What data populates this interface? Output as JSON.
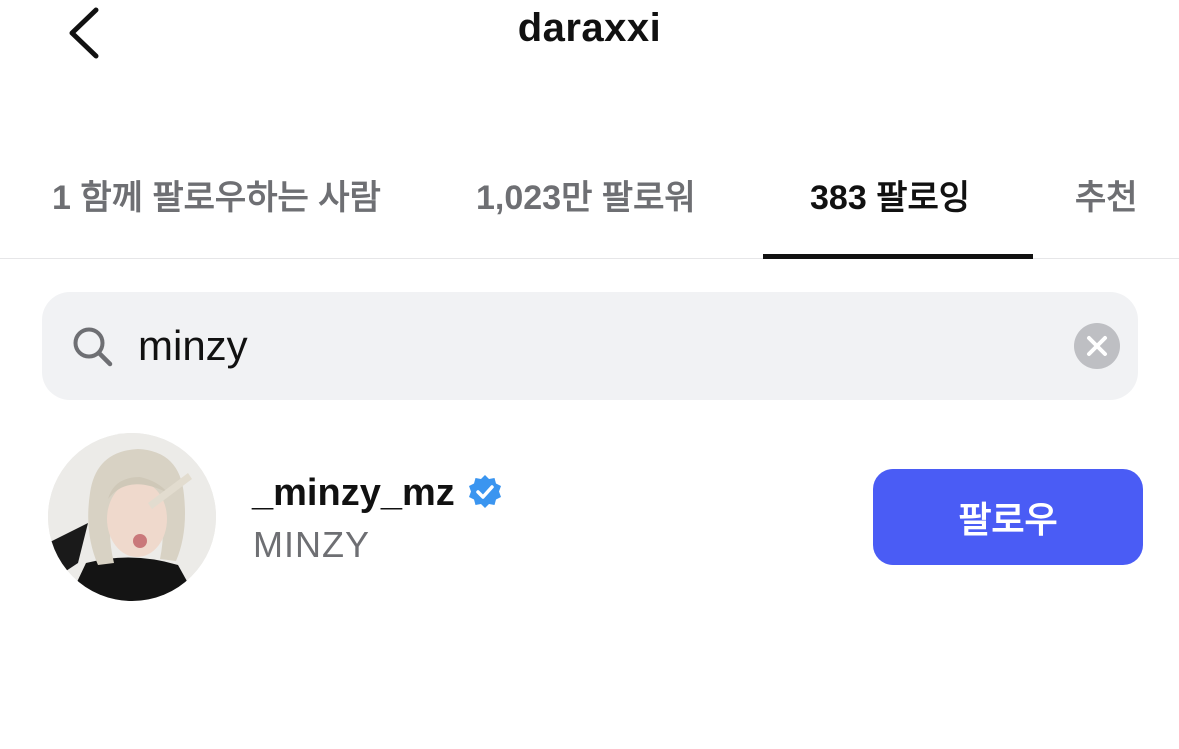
{
  "header": {
    "title": "daraxxi",
    "back_icon": "chevron-left-icon"
  },
  "tabs": [
    {
      "label": "1 함께 팔로우하는 사람",
      "active": false
    },
    {
      "label": "1,023만 팔로워",
      "active": false
    },
    {
      "label": "383 팔로잉",
      "active": true
    },
    {
      "label": "추천",
      "active": false
    }
  ],
  "search": {
    "value": "minzy",
    "icon": "search-icon",
    "clear_icon": "close-icon"
  },
  "results": [
    {
      "username": "_minzy_mz",
      "display_name": "MINZY",
      "verified": true,
      "follow_label": "팔로우"
    }
  ],
  "colors": {
    "accent": "#4a5cf5",
    "verified": "#3a95f0",
    "muted_text": "#6e6f73",
    "search_bg": "#f1f2f4"
  }
}
